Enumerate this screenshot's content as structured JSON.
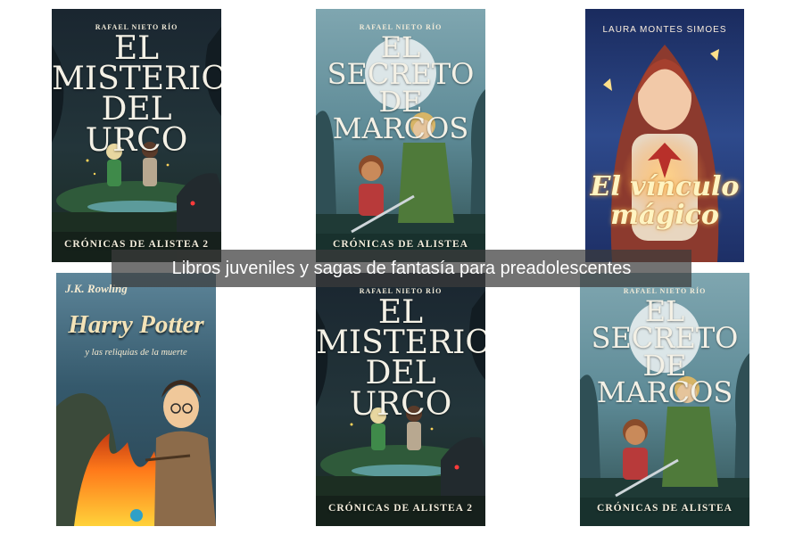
{
  "caption": "Libros juveniles y sagas de fantasía para preadolescentes",
  "books": [
    {
      "author": "RAFAEL NIETO RÍO",
      "title": "EL\nMISTERIO\nDEL URCO",
      "series": "CRÓNICAS DE ALISTEA 2",
      "illustration": "two-children-forest-wolf"
    },
    {
      "author": "RAFAEL NIETO RÍO",
      "title": "EL SECRETO\nDE MARCOS",
      "series": "CRÓNICAS DE ALISTEA",
      "illustration": "boy-and-archer-moon"
    },
    {
      "author": "LAURA MONTES SIMOES",
      "title": "El vínculo\nmágico",
      "illustration": "girl-with-dragon-butterflies"
    },
    {
      "author": "J.K. Rowling",
      "title": "Harry Potter",
      "subtitle": "y las reliquias de la muerte",
      "illustration": "harry-fire-hooded-figure"
    },
    {
      "author": "RAFAEL NIETO RÍO",
      "title": "EL\nMISTERIO\nDEL URCO",
      "series": "CRÓNICAS DE ALISTEA 2",
      "illustration": "two-children-forest-wolf"
    },
    {
      "author": "RAFAEL NIETO RÍO",
      "title": "EL SECRETO\nDE MARCOS",
      "series": "CRÓNICAS DE ALISTEA",
      "illustration": "boy-and-archer-moon"
    }
  ],
  "colors": {
    "urco_bg": "#1d2a33",
    "marcos_bg": "#5f8fa0",
    "vinculo_bg": "#233c78",
    "hp_bg": "#2f5368",
    "caption_bg": "#3c3c3c"
  }
}
